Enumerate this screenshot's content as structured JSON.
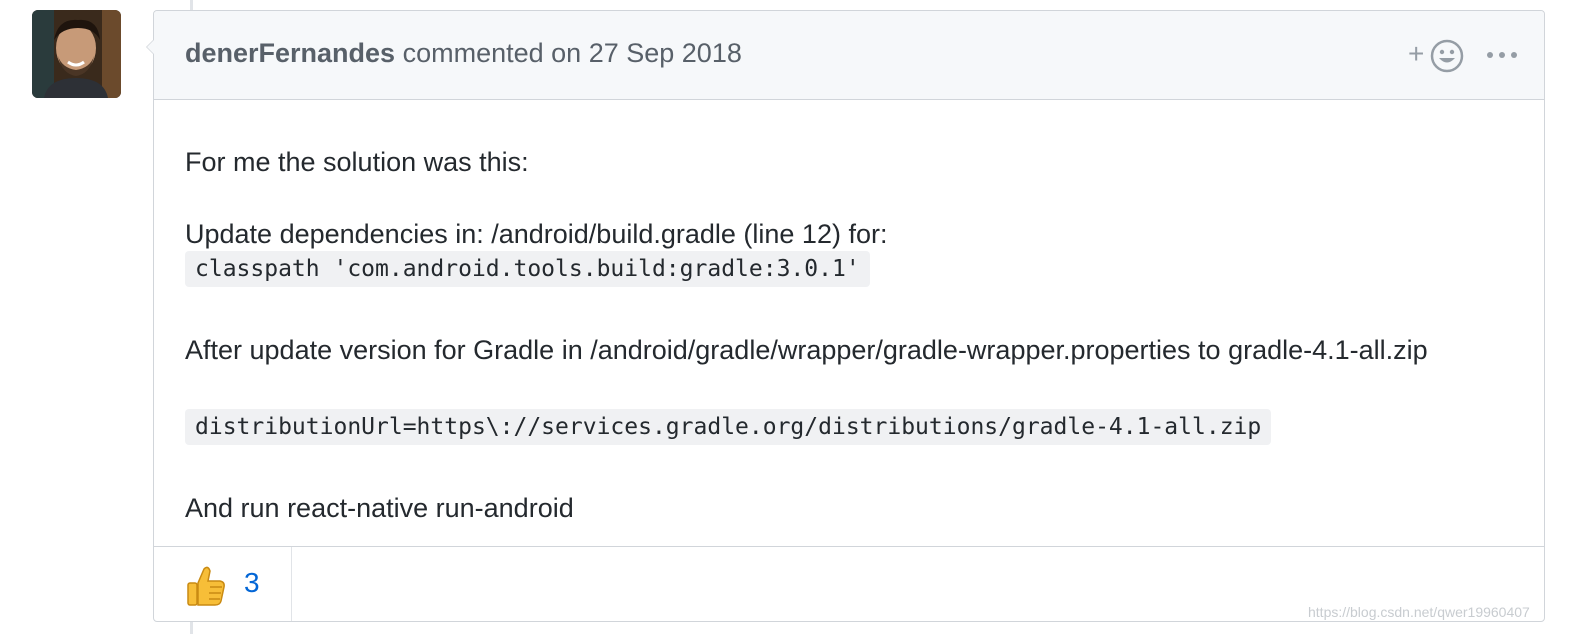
{
  "comment": {
    "author": "denerFernandes",
    "action": "commented on",
    "date": "27 Sep 2018",
    "body": {
      "line1": "For me the solution was this:",
      "line2": "Update dependencies in: /android/build.gradle (line 12) for:",
      "code1": "classpath 'com.android.tools.build:gradle:3.0.1'",
      "line3": "After update version for Gradle in /android/gradle/wrapper/gradle-wrapper.properties to gradle-4.1-all.zip",
      "code2": "distributionUrl=https\\://services.gradle.org/distributions/gradle-4.1-all.zip",
      "line4": "And run react-native run-android"
    },
    "add_reaction_plus": "+",
    "reactions": [
      {
        "icon": "thumbs-up-icon",
        "count": "3"
      }
    ]
  },
  "watermark": "https://blog.csdn.net/qwer19960407",
  "colors": {
    "header_bg": "#f6f8fa",
    "border": "#d1d5da",
    "link_blue": "#0366d6",
    "muted_text": "#586069"
  }
}
